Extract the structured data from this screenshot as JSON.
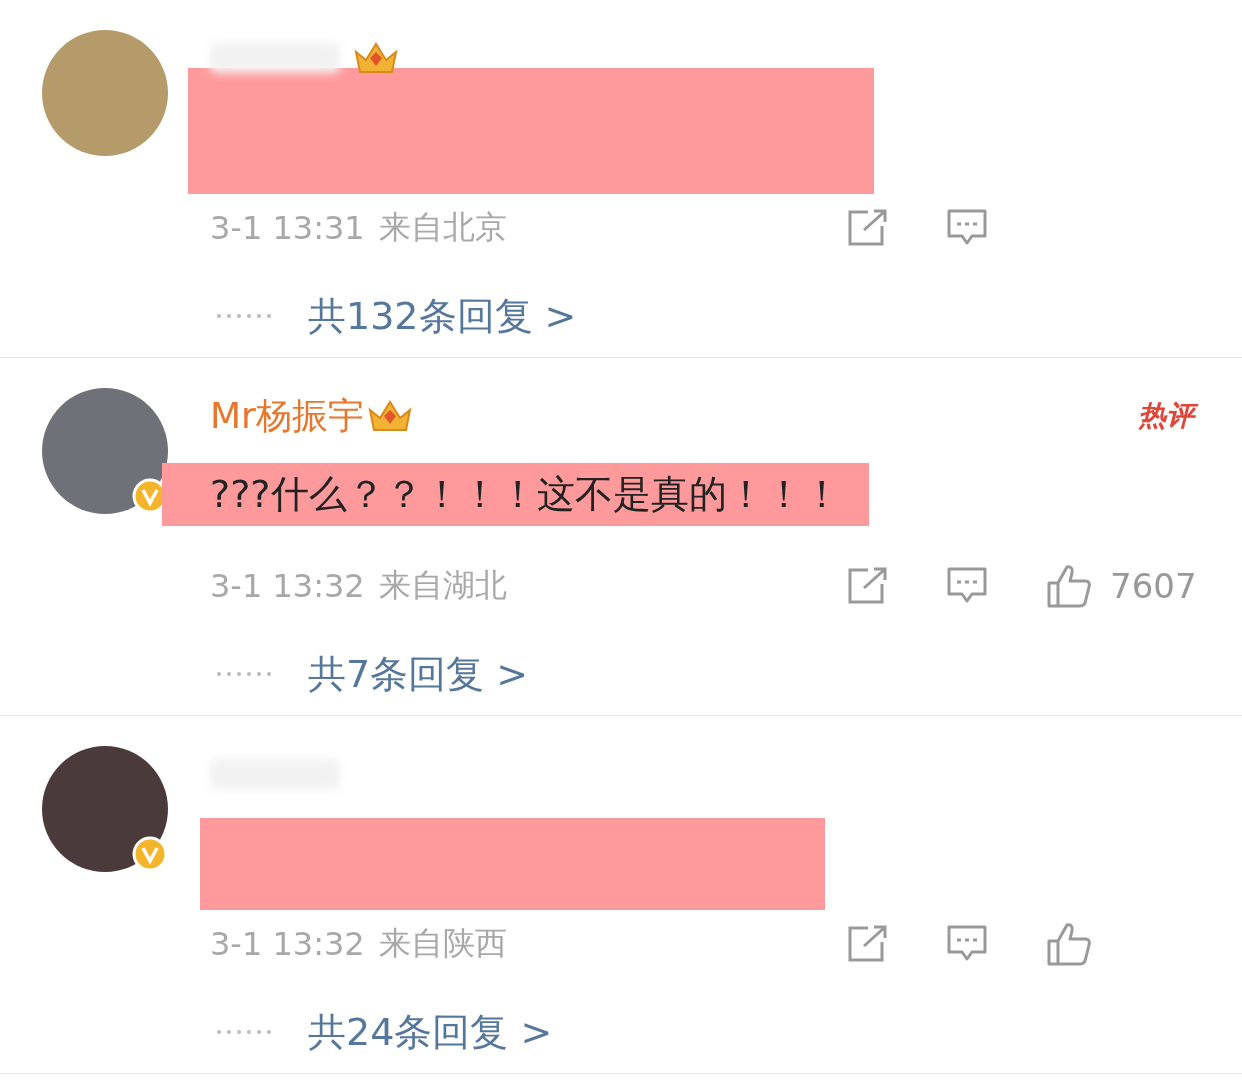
{
  "comments": [
    {
      "crown": true,
      "verified": false,
      "redacted": true,
      "time": "3-1 13:31",
      "location": "来自北京",
      "like": false,
      "replies": "共132条回复 >"
    },
    {
      "name": "Mr杨振宇",
      "crown": true,
      "verified": true,
      "badge": "热评",
      "text": "???什么？？！！！这不是真的！！！",
      "highlighted": true,
      "time": "3-1 13:32",
      "location": "来自湖北",
      "like": true,
      "likes": "7607",
      "replies": "共7条回复 >"
    },
    {
      "crown": false,
      "verified": true,
      "redacted": true,
      "time": "3-1 13:32",
      "location": "来自陕西",
      "like": true,
      "replies": "共24条回复 >"
    }
  ]
}
